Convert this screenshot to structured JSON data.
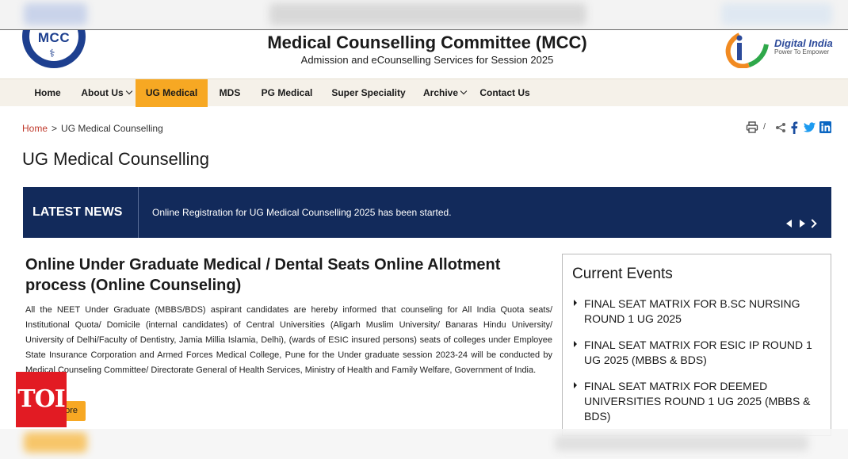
{
  "header": {
    "logo_text": "MCC",
    "title": "Medical Counselling Committee (MCC)",
    "subtitle": "Admission and eCounselling Services for Session 2025",
    "digital_india_name": "Digital India",
    "digital_india_tagline": "Power To Empower"
  },
  "nav": {
    "items": [
      {
        "label": "Home"
      },
      {
        "label": "About Us",
        "has_dropdown": true
      },
      {
        "label": "UG Medical",
        "active": true
      },
      {
        "label": "MDS"
      },
      {
        "label": "PG Medical"
      },
      {
        "label": "Super Speciality"
      },
      {
        "label": "Archive",
        "has_dropdown": true
      },
      {
        "label": "Contact Us"
      }
    ]
  },
  "breadcrumb": {
    "home": "Home",
    "separator": ">",
    "current": "UG Medical Counselling"
  },
  "tools": {
    "icons": [
      "print-icon",
      "share-icon",
      "facebook-icon",
      "twitter-icon",
      "linkedin-icon"
    ],
    "divider": "/"
  },
  "page": {
    "title": "UG Medical Counselling"
  },
  "news": {
    "label": "LATEST NEWS",
    "text": "Online Registration for UG Medical Counselling 2025 has been started."
  },
  "article": {
    "title": "Online Under Graduate Medical / Dental Seats Online Allotment process (Online Counseling)",
    "body": "All the NEET Under Graduate (MBBS/BDS) aspirant candidates are hereby informed that counseling for All India Quota seats/ Institutional Quota/ Domicile (internal candidates) of Central Universities (Aligarh Muslim University/ Banaras Hindu University/ University of Delhi/Faculty of Dentistry, Jamia Millia Islamia, Delhi), (wards of ESIC insured persons) seats of colleges under Employee State Insurance Corporation and Armed Forces Medical College, Pune for the Under graduate session 2023-24 will be conducted by Medical Counseling Committee/ Directorate General of Health Services, Ministry of Health and Family Welfare, Government of India.",
    "more_label": "More"
  },
  "watermark": {
    "text": "TOI"
  },
  "events": {
    "title": "Current Events",
    "items": [
      "FINAL SEAT MATRIX FOR B.SC NURSING ROUND 1 UG 2025",
      "FINAL SEAT MATRIX FOR ESIC IP ROUND 1 UG 2025 (MBBS & BDS)",
      "FINAL SEAT MATRIX FOR DEEMED UNIVERSITIES ROUND 1 UG 2025 (MBBS & BDS)"
    ]
  },
  "colors": {
    "accent": "#f7a823",
    "news_bg": "#122a5b",
    "nav_bg": "#f5f1e9",
    "crumb_home": "#c0392b",
    "toi_red": "#e21b23",
    "mcc_blue": "#1d3f8f"
  }
}
